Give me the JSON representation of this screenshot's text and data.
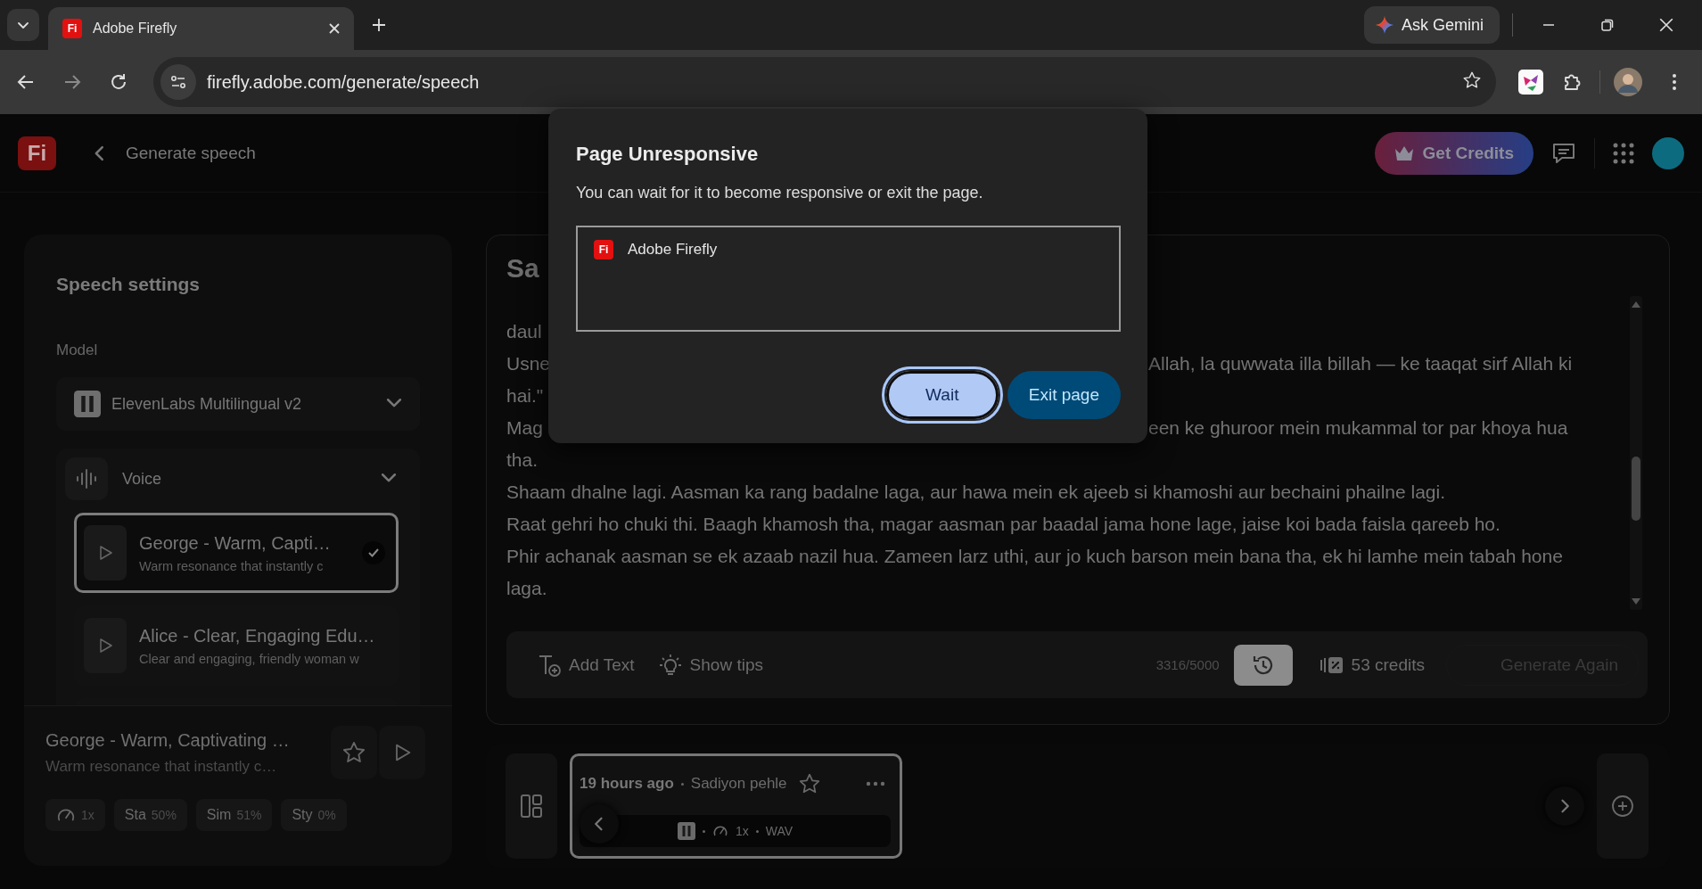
{
  "browser": {
    "tab": {
      "icon_text": "Fi",
      "title": "Adobe Firefly"
    },
    "address": "firefly.adobe.com/generate/speech",
    "gemini": "Ask Gemini"
  },
  "header": {
    "logo": "Fi",
    "title": "Generate speech",
    "get_credits": "Get Credits"
  },
  "settings": {
    "title": "Speech settings",
    "model_label": "Model",
    "model": "ElevenLabs Multilingual v2",
    "voice_label": "Voice",
    "voices": [
      {
        "name": "George - Warm, Capti…",
        "description": "Warm resonance that instantly c",
        "selected": true
      },
      {
        "name": "Alice - Clear, Engaging Edu…",
        "description": "Clear and engaging, friendly woman w",
        "selected": false
      }
    ],
    "current": {
      "name": "George - Warm, Captivating …",
      "description": "Warm resonance that instantly c…"
    },
    "chips": [
      {
        "kind": "speed",
        "value": "1x"
      },
      {
        "kind": "stat",
        "label": "Sta",
        "value": "50%"
      },
      {
        "kind": "stat",
        "label": "Sim",
        "value": "51%"
      },
      {
        "kind": "stat",
        "label": "Sty",
        "value": "0%"
      }
    ]
  },
  "editor": {
    "title": "Sa",
    "lines": [
      {
        "start": "daul"
      },
      {
        "start": "Usne",
        "end": "Allah, la quwwata illa billah — ke taaqat sirf Allah ki"
      },
      {
        "start": "hai.\""
      },
      {
        "start": "Mag",
        "end": "een ke ghuroor mein mukammal tor par khoya hua"
      },
      {
        "start": "tha."
      },
      {
        "start": "Shaam dhalne lagi. Aasman ka rang badalne laga, aur hawa mein ek ajeeb si khamoshi aur bechaini phailne lagi."
      },
      {
        "start": "Raat gehri ho chuki thi. Baagh khamosh tha, magar aasman par baadal jama hone lage, jaise koi bada faisla qareeb ho."
      },
      {
        "start": "Phir achanak aasman se ek azaab nazil hua. Zameen larz uthi, aur jo kuch barson mein bana tha, ek hi lamhe mein tabah hone"
      },
      {
        "start": "laga."
      }
    ],
    "add_text": "Add Text",
    "show_tips": "Show tips",
    "char_count": "3316/5000",
    "credits": "53 credits",
    "generate": {
      "label": "Generate Again",
      "disabled": true
    }
  },
  "history": {
    "cards": [
      {
        "time": "19 hours ago",
        "title": "Sadiyon pehle",
        "speed": "1x",
        "format": "WAV",
        "selected": true
      }
    ]
  },
  "dialog": {
    "title": "Page Unresponsive",
    "message": "You can wait for it to become responsive or exit the page.",
    "app": {
      "icon_text": "Fi",
      "name": "Adobe Firefly"
    },
    "buttons": [
      {
        "label": "Wait",
        "kind": "tonal",
        "focused": true
      },
      {
        "label": "Exit page",
        "kind": "filled",
        "focused": false
      }
    ]
  }
}
